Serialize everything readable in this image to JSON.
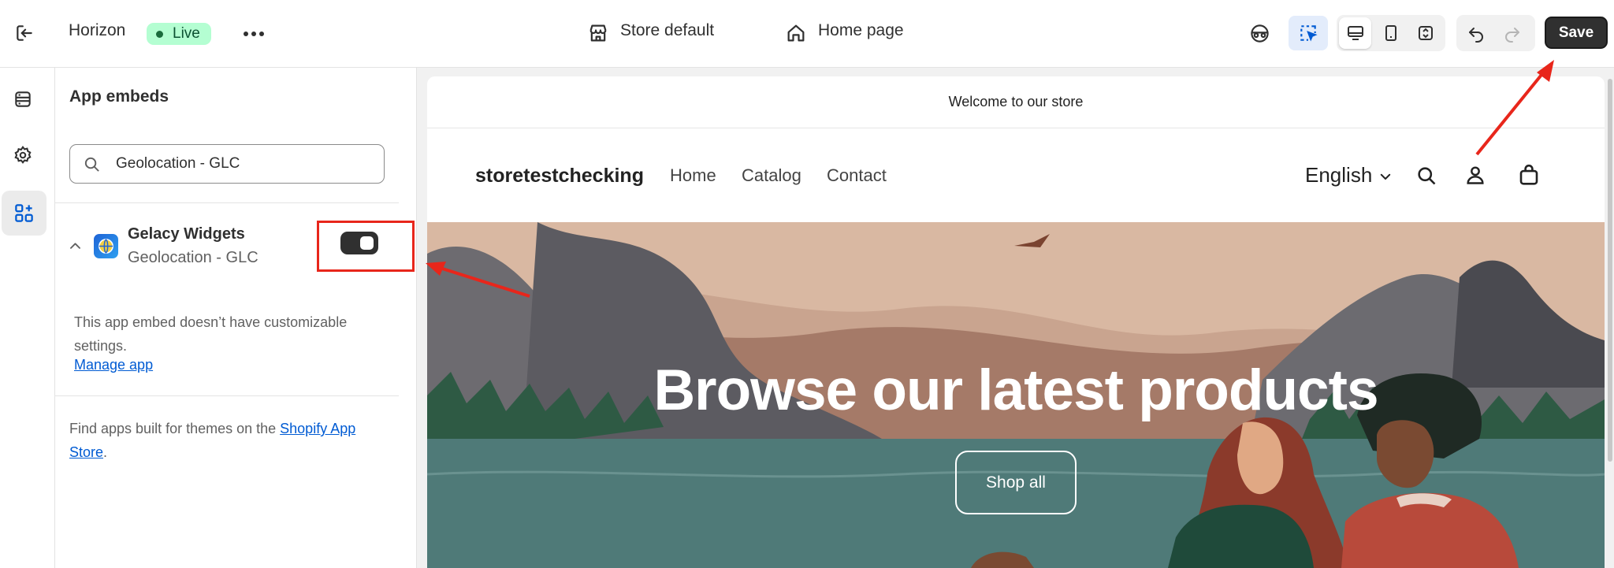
{
  "topbar": {
    "theme_name": "Horizon",
    "status_badge": "Live",
    "store_selector": "Store default",
    "page_selector": "Home page",
    "save_label": "Save"
  },
  "sidebar": {
    "title": "App embeds",
    "search_value": "Geolocation - GLC",
    "app": {
      "name": "Gelacy Widgets",
      "embed_name": "Geolocation - GLC",
      "enabled": true
    },
    "embed_note": "This app embed doesn’t have customizable settings.",
    "manage_app": "Manage app",
    "find_apps_prefix": "Find apps built for themes on the ",
    "find_apps_link": "Shopify App Store",
    "find_apps_suffix": "."
  },
  "preview": {
    "announcement": "Welcome to our store",
    "store_name": "storetestchecking",
    "nav": [
      "Home",
      "Catalog",
      "Contact"
    ],
    "language": "English",
    "hero_title": "Browse our latest products",
    "hero_button": "Shop all"
  },
  "colors": {
    "accent_link": "#005bd3",
    "annotation_red": "#e8261b",
    "live_badge": "#b4fed2",
    "save_button": "#303030"
  },
  "icons": [
    "exit-icon",
    "more-icon",
    "store-icon",
    "home-icon",
    "visibility-icon",
    "inspector-icon",
    "desktop-icon",
    "mobile-icon",
    "fullscreen-icon",
    "undo-icon",
    "redo-icon",
    "sections-icon",
    "settings-icon",
    "app-embeds-icon",
    "search-icon",
    "chevron-up-icon",
    "globe-icon",
    "account-icon",
    "cart-icon",
    "chevron-down-icon"
  ]
}
